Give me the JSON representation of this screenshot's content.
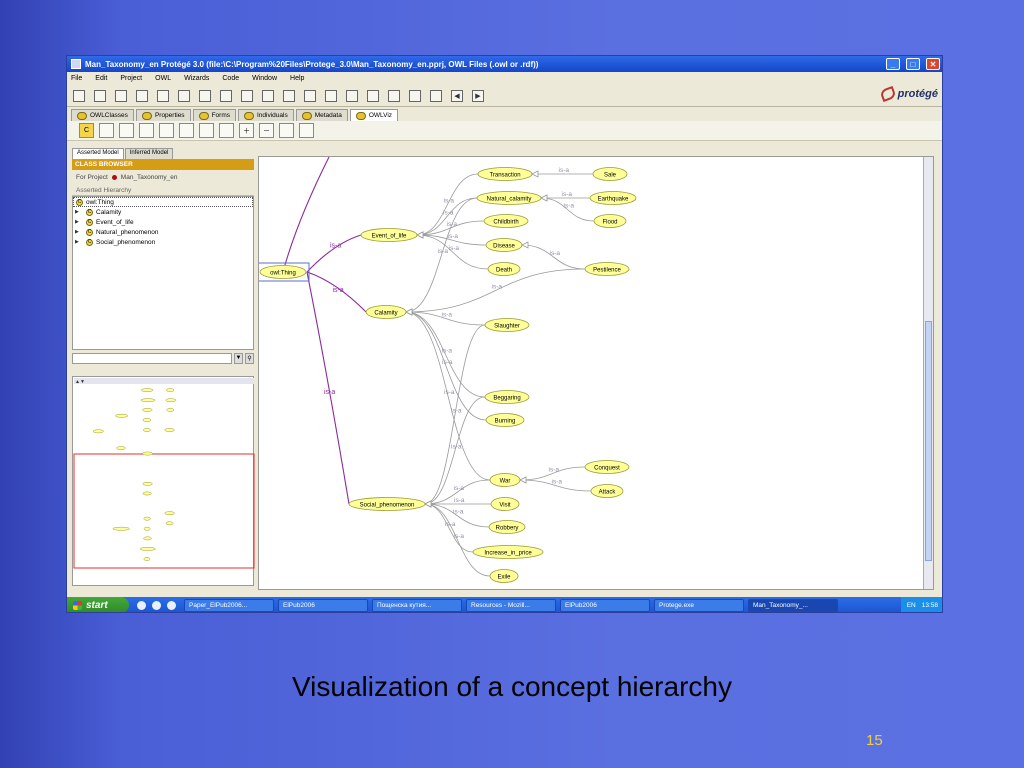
{
  "window": {
    "title": "Man_Taxonomy_en  Protégé 3.0     (file:\\C:\\Program%20Files\\Protege_3.0\\Man_Taxonomy_en.pprj, OWL Files (.owl or .rdf))",
    "controls": {
      "minimize": "_",
      "maximize": "□",
      "close": "✕"
    }
  },
  "menu": [
    "File",
    "Edit",
    "Project",
    "OWL",
    "Wizards",
    "Code",
    "Window",
    "Help"
  ],
  "logo_text": "protégé",
  "tabs": [
    {
      "label": "OWLClasses",
      "active": false
    },
    {
      "label": "Properties",
      "active": false
    },
    {
      "label": "Forms",
      "active": false
    },
    {
      "label": "Individuals",
      "active": false
    },
    {
      "label": "Metadata",
      "active": false
    },
    {
      "label": "OWLViz",
      "active": true
    }
  ],
  "model_tabs": [
    {
      "label": "Asserted Model",
      "active": true
    },
    {
      "label": "Inferred Model",
      "active": false
    }
  ],
  "class_browser": {
    "header": "CLASS BROWSER",
    "for_project_label": "For Project",
    "project_name": "Man_Taxonomy_en",
    "hierarchy_label": "Asserted Hierarchy",
    "root": "owl:Thing",
    "children": [
      "Calamity",
      "Event_of_life",
      "Natural_phenomenon",
      "Social_phenomenon"
    ]
  },
  "graph": {
    "edge_label": "is-a",
    "root": "owl:Thing",
    "nodes": [
      "Transaction",
      "Sale",
      "Natural_calamity",
      "Earthquake",
      "Childbirth",
      "Flood",
      "Event_of_life",
      "Disease",
      "Death",
      "Pestilence",
      "Calamity",
      "Slaughter",
      "Beggaring",
      "Burning",
      "War",
      "Conquest",
      "Attack",
      "Social_phenomenon",
      "Visit",
      "Robbery",
      "Increase_in_price",
      "Exile"
    ]
  },
  "taskbar": {
    "start": "start",
    "items": [
      {
        "label": "Paper_ElPub2006...",
        "active": false
      },
      {
        "label": "ElPub2006",
        "active": false
      },
      {
        "label": "Пощенска кутия...",
        "active": false
      },
      {
        "label": "Resources - Mozill...",
        "active": false
      },
      {
        "label": "ElPub2006",
        "active": false
      },
      {
        "label": "Protege.exe",
        "active": false
      },
      {
        "label": "Man_Taxonomy_...",
        "active": true
      }
    ],
    "lang": "EN",
    "clock": "13:58"
  },
  "caption": "Visualization of a concept hierarchy",
  "page_number": "15",
  "colors": {
    "node_fill": "#ffff99",
    "node_stroke": "#9a9a30",
    "root_edge": "#8b2a9e",
    "edge": "#9a9a9a",
    "edge_label": "#9090a8",
    "header_bar": "#d59c16",
    "caption_number": "#f0d040"
  }
}
